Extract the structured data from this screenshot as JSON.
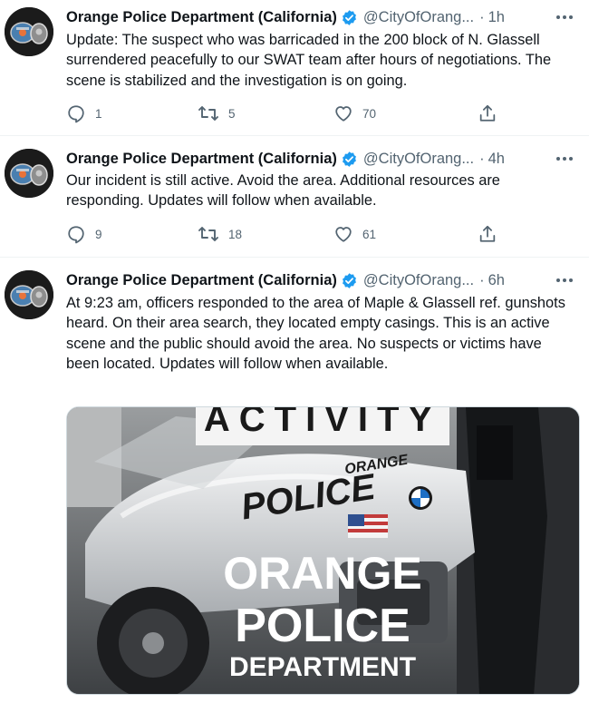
{
  "tweets": [
    {
      "author_name": "Orange Police Department (California)",
      "handle": "@CityOfOrang...",
      "separator": "·",
      "time": "1h",
      "text": "Update: The suspect who was barricaded in the 200 block of N. Glassell surrendered peacefully to our SWAT team after hours of negotiations. The scene is stabilized and the investigation is on going.",
      "replies": "1",
      "retweets": "5",
      "likes": "70"
    },
    {
      "author_name": "Orange Police Department (California)",
      "handle": "@CityOfOrang...",
      "separator": "·",
      "time": "4h",
      "text": "Our incident is still active.  Avoid the area. Additional resources are responding. Updates will follow when available.",
      "replies": "9",
      "retweets": "18",
      "likes": "61"
    },
    {
      "author_name": "Orange Police Department (California)",
      "handle": "@CityOfOrang...",
      "separator": "·",
      "time": "6h",
      "text": "At 9:23 am, officers responded to the area of Maple & Glassell ref. gunshots heard. On their area search, they located empty casings. This is an active scene and the public should avoid the area. No suspects or victims have been located. Updates will follow when available.",
      "media": {
        "banner_text": "ACTIVITY",
        "bike_brand_text": "ORANGE",
        "bike_text": "POLICE",
        "overlay_line1": "ORANGE",
        "overlay_line2": "POLICE",
        "overlay_line3": "DEPARTMENT"
      }
    }
  ],
  "icons": {
    "verified": "verified-badge-icon",
    "more": "more-dots-icon",
    "reply": "reply-icon",
    "retweet": "retweet-icon",
    "like": "heart-icon",
    "share": "share-icon"
  },
  "colors": {
    "verified_blue": "#1d9bf0",
    "text_primary": "#0f1419",
    "text_secondary": "#536471",
    "divider": "#eff3f4"
  }
}
